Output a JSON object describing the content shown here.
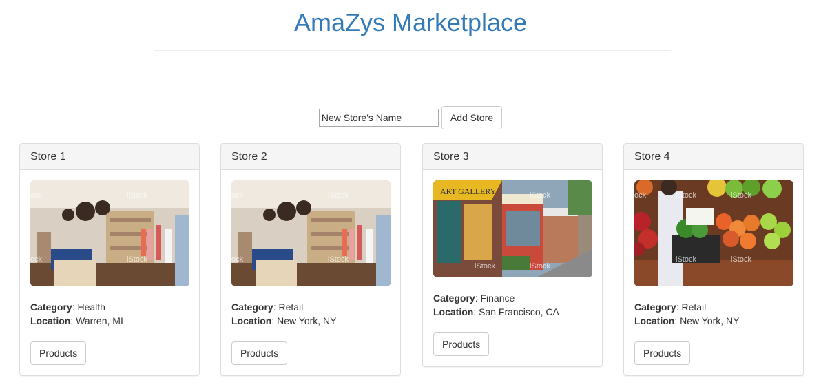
{
  "header": {
    "title": "AmaZys Marketplace"
  },
  "add_store": {
    "input_value": "New Store's Name",
    "button_label": "Add Store"
  },
  "labels": {
    "category": "Category",
    "location": "Location",
    "products_button": "Products"
  },
  "stores": [
    {
      "name": "Store 1",
      "category": "Health",
      "location": "Warren, MI",
      "image": "clothing-boutique-interior"
    },
    {
      "name": "Store 2",
      "category": "Retail",
      "location": "New York, NY",
      "image": "clothing-boutique-interior"
    },
    {
      "name": "Store 3",
      "category": "Finance",
      "location": "San Francisco, CA",
      "image": "storefront-street-art-gallery"
    },
    {
      "name": "Store 4",
      "category": "Retail",
      "location": "New York, NY",
      "image": "produce-market-shopper"
    }
  ],
  "watermark": "iStock",
  "colors": {
    "title": "#337ab7",
    "panel_heading_bg": "#f5f5f5",
    "border": "#dddddd"
  }
}
